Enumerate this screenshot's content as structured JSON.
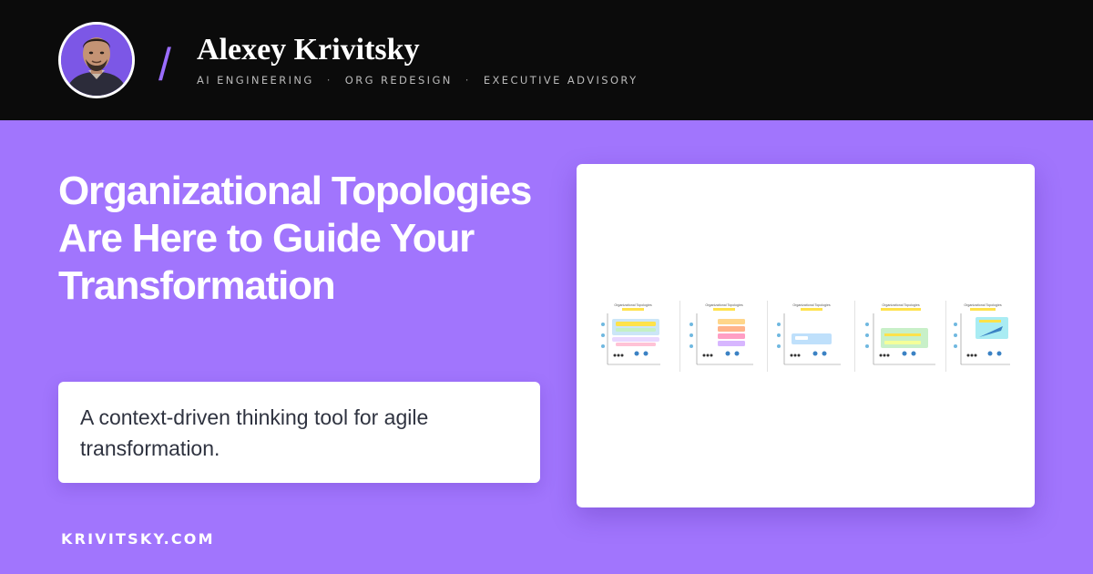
{
  "header": {
    "author_name": "Alexey Krivitsky",
    "tagline": [
      "AI ENGINEERING",
      "ORG REDESIGN",
      "EXECUTIVE ADVISORY"
    ],
    "tagline_separator": "·",
    "divider": "/"
  },
  "main": {
    "title": "Organizational Topologies Are Here to Guide Your Transformation",
    "subtitle": "A context-driven thinking tool for agile transformation."
  },
  "footer": {
    "site_url": "KRIVITSKY.COM"
  },
  "preview": {
    "slides": [
      {
        "title": "Organizational Topologies"
      },
      {
        "title": "Organizational Topologies"
      },
      {
        "title": "Organizational Topologies"
      },
      {
        "title": "Organizational Topologies"
      },
      {
        "title": "Organizational Topologies"
      }
    ]
  },
  "colors": {
    "background": "#a175fd",
    "header_background": "#0b0b0b",
    "accent": "#9b6dff",
    "card": "#ffffff"
  }
}
